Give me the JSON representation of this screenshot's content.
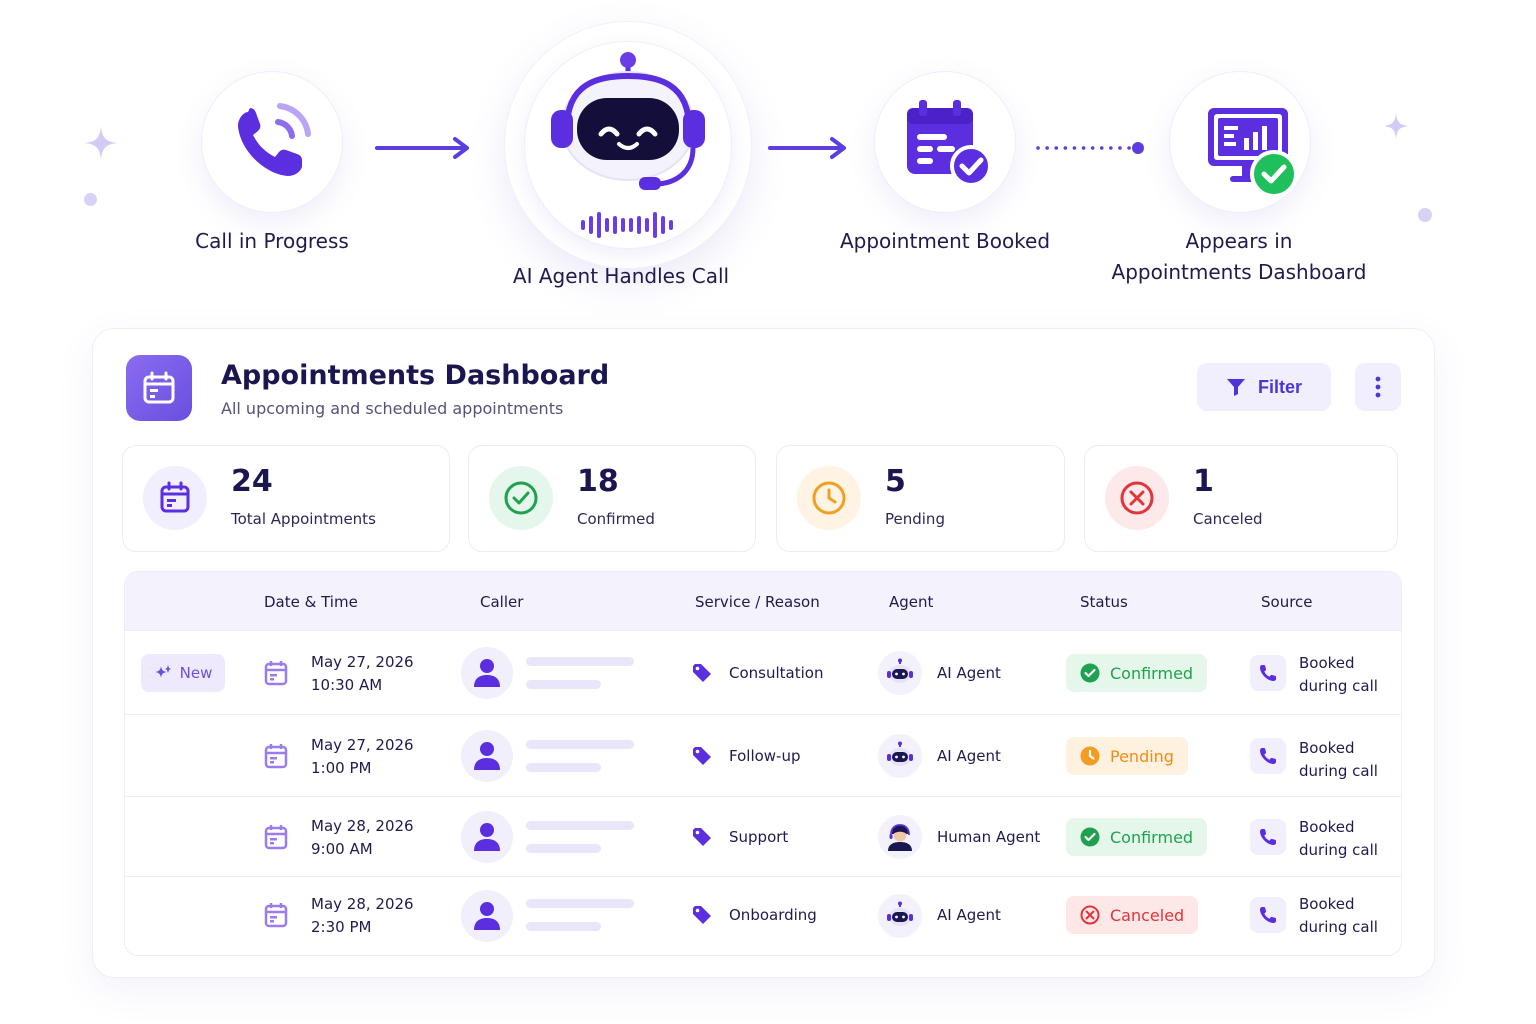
{
  "flow": {
    "steps": [
      {
        "label": "Call in Progress",
        "icon": "phone-call-icon"
      },
      {
        "label": "AI Agent Handles Call",
        "icon": "robot-headset-icon"
      },
      {
        "label": "Appointment Booked",
        "icon": "calendar-check-icon"
      },
      {
        "label_line1": "Appears in",
        "label_line2": "Appointments Dashboard",
        "icon": "monitor-chart-icon"
      }
    ]
  },
  "dashboard": {
    "title": "Appointments Dashboard",
    "subtitle": "All upcoming and scheduled appointments",
    "filter_label": "Filter",
    "stats": [
      {
        "value": "24",
        "label": "Total Appointments",
        "icon": "calendar-icon",
        "color": "#6a4fe0"
      },
      {
        "value": "18",
        "label": "Confirmed",
        "icon": "check-circle-icon",
        "color": "#1fa24f"
      },
      {
        "value": "5",
        "label": "Pending",
        "icon": "clock-icon",
        "color": "#f0a020"
      },
      {
        "value": "1",
        "label": "Canceled",
        "icon": "x-circle-icon",
        "color": "#e0353a"
      }
    ],
    "columns": [
      "Date & Time",
      "Caller",
      "Service / Reason",
      "Agent",
      "Status",
      "Source"
    ],
    "new_label": "New",
    "rows": [
      {
        "date": "May 27, 2026",
        "time": "10:30 AM",
        "service": "Consultation",
        "agent": "AI Agent",
        "status": "Confirmed",
        "source_line1": "Booked",
        "source_line2": "during call"
      },
      {
        "date": "May 27, 2026",
        "time": "1:00 PM",
        "service": "Follow-up",
        "agent": "AI Agent",
        "status": "Pending",
        "source_line1": "Booked",
        "source_line2": "during call"
      },
      {
        "date": "May 28, 2026",
        "time": "9:00 AM",
        "service": "Support",
        "agent": "Human Agent",
        "status": "Confirmed",
        "source_line1": "Booked",
        "source_line2": "during call"
      },
      {
        "date": "May 28, 2026",
        "time": "2:30 PM",
        "service": "Onboarding",
        "agent": "AI Agent",
        "status": "Canceled",
        "source_line1": "Booked",
        "source_line2": "during call"
      }
    ]
  },
  "colors": {
    "brand": "#6a4fe0",
    "confirmed": "#1fa24f",
    "pending": "#f08c12",
    "canceled": "#e0353a"
  }
}
